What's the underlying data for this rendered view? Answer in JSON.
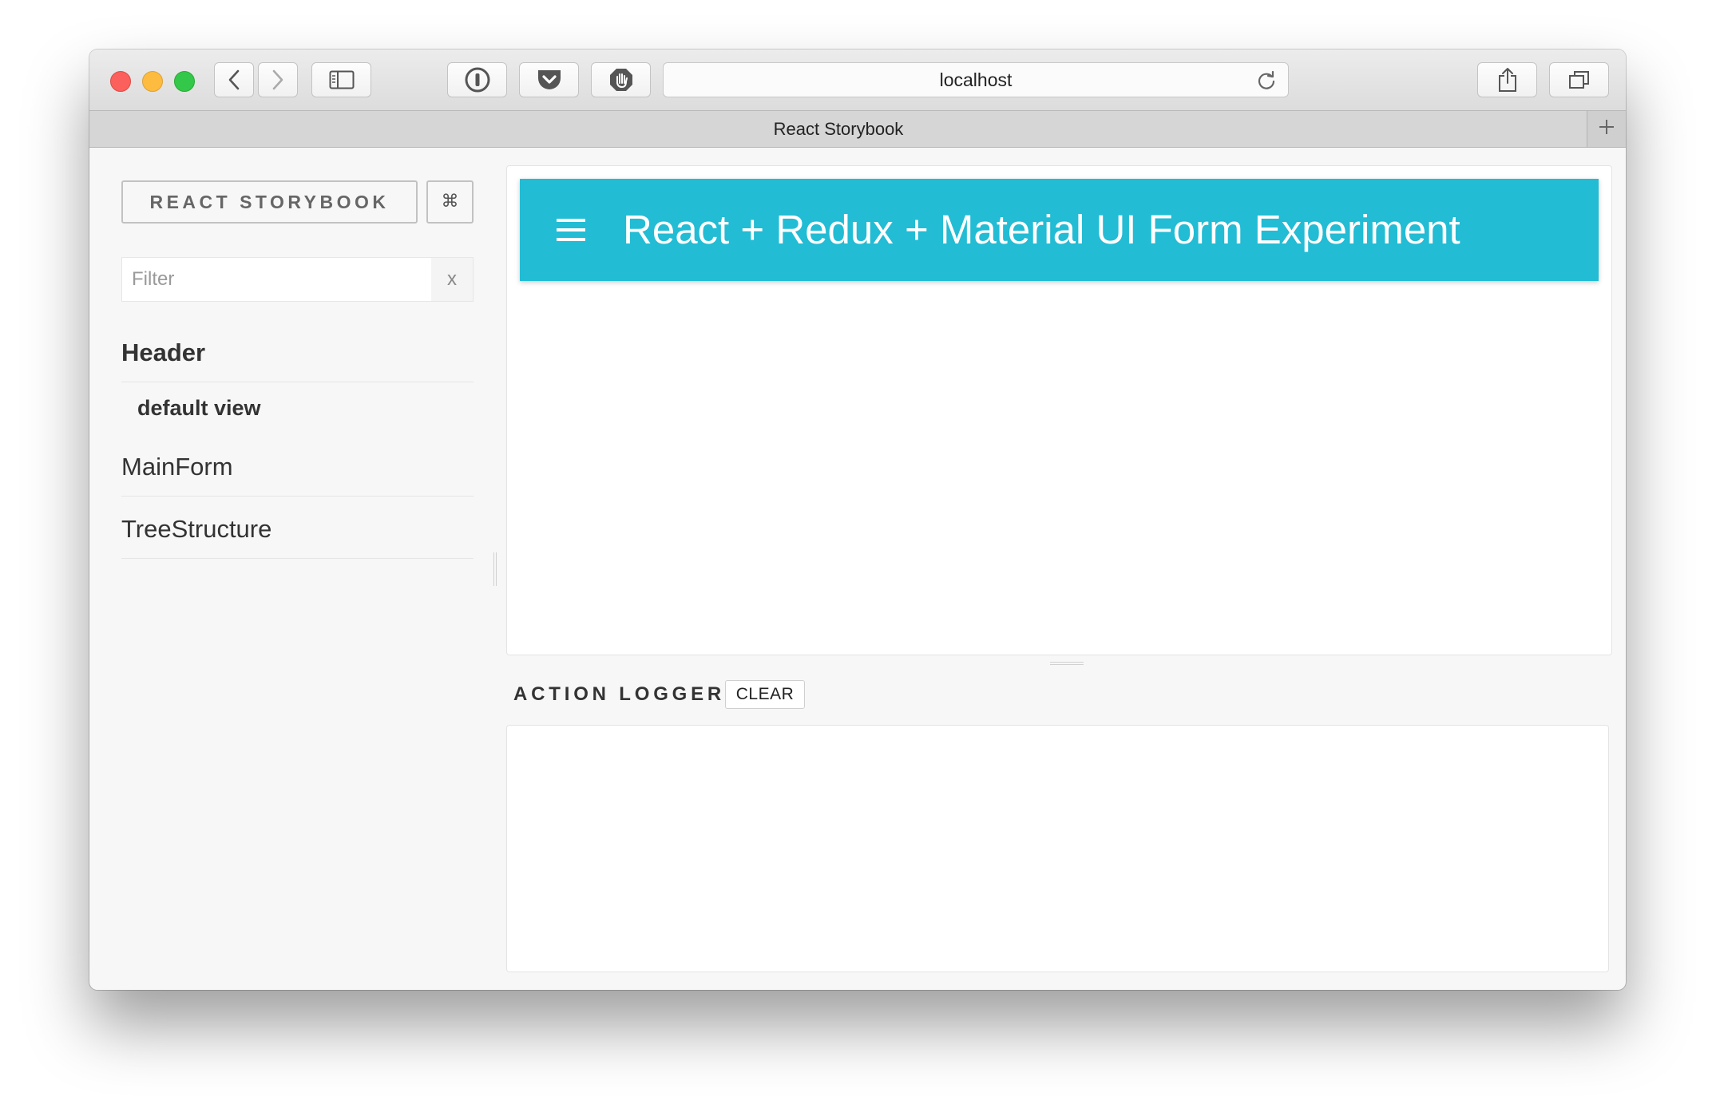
{
  "browser": {
    "address": "localhost",
    "tab_title": "React Storybook",
    "icons": [
      "back-icon",
      "forward-icon",
      "sidebar-icon",
      "password-manager-icon",
      "pocket-icon",
      "adblock-icon",
      "reload-icon",
      "share-icon",
      "tabs-icon",
      "plus-icon"
    ]
  },
  "sidebar": {
    "brand": "REACT STORYBOOK",
    "shortcut_label": "⌘",
    "filter_placeholder": "Filter",
    "filter_value": "",
    "filter_clear": "x",
    "kinds": [
      {
        "name": "Header",
        "selected": true,
        "stories": [
          "default view"
        ]
      },
      {
        "name": "MainForm",
        "selected": false,
        "stories": []
      },
      {
        "name": "TreeStructure",
        "selected": false,
        "stories": []
      }
    ]
  },
  "preview": {
    "appbar_title": "React + Redux + Material UI Form Experiment",
    "appbar_color": "#22bcd4",
    "menu_icon": "hamburger-menu-icon"
  },
  "action_logger": {
    "title": "ACTION LOGGER",
    "clear_label": "CLEAR",
    "entries": []
  }
}
